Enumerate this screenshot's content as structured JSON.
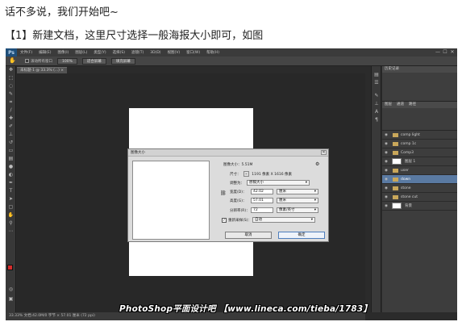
{
  "intro": {
    "line1": "话不多说，我们开始吧~",
    "line2": "【1】新建文档，这里尺寸选择一般海报大小即可，如图"
  },
  "app": {
    "logo": "Ps",
    "menu": [
      "文件(F)",
      "编辑(E)",
      "图像(I)",
      "图层(L)",
      "类型(Y)",
      "选择(S)",
      "滤镜(T)",
      "3D(D)",
      "视图(V)",
      "窗口(W)",
      "帮助(H)"
    ],
    "window_controls": [
      "—",
      "☐",
      "✕"
    ]
  },
  "options_bar": {
    "tool_glyph": "✋",
    "scroll_all_label": "滚动所有窗口",
    "buttons": [
      "100%",
      "适合屏幕",
      "填充屏幕"
    ]
  },
  "document": {
    "tab_title": "未标题-1 @ 33.3% (...) ×"
  },
  "status_bar": {
    "text": "33.33%   文档:42.0M/0 字节  ×  57.01  厘米  (72 ppi)"
  },
  "watermark": {
    "text": "PhotoShop平面设计吧 【www.lineca.com/tieba/1783】"
  },
  "dialog": {
    "title": "图像大小",
    "close_glyph": "✕",
    "image_size_label": "图像大小：",
    "image_size_value": "5.51M",
    "dimensions_label": "尺寸：",
    "dimensions_value": "1191 像素 X 1616 像素",
    "fit_label": "调整为：",
    "fit_value": "原稿大小",
    "width_label": "宽度(D)：",
    "width_value": "42.02",
    "width_unit": "厘米",
    "height_label": "高度(G)：",
    "height_value": "57.01",
    "height_unit": "厘米",
    "resolution_label": "分辨率(R)：",
    "resolution_value": "72",
    "resolution_unit": "像素/英寸",
    "resample_label": "重新采样(S)：",
    "resample_value": "自动",
    "cancel_label": "取消",
    "ok_label": "确定"
  },
  "layers": {
    "tabs": [
      "图层",
      "通道",
      "路径"
    ],
    "items": [
      {
        "name": "comp light",
        "type": "group",
        "selected": false
      },
      {
        "name": "comp 1c",
        "type": "group",
        "selected": false
      },
      {
        "name": "Comp3",
        "type": "group",
        "selected": false
      },
      {
        "name": "图层 1",
        "type": "layer",
        "selected": false
      },
      {
        "name": "user",
        "type": "group",
        "selected": false
      },
      {
        "name": "down",
        "type": "group",
        "selected": true
      },
      {
        "name": "stone",
        "type": "group",
        "selected": false
      },
      {
        "name": "stone cut",
        "type": "group",
        "selected": false
      },
      {
        "name": "背景",
        "type": "layer",
        "selected": false
      }
    ]
  },
  "panel_top": {
    "tab": "历史记录"
  },
  "colors": {
    "foreground": "#d72c2c",
    "background": "#ffffff",
    "selection": "#5a7aa2"
  }
}
